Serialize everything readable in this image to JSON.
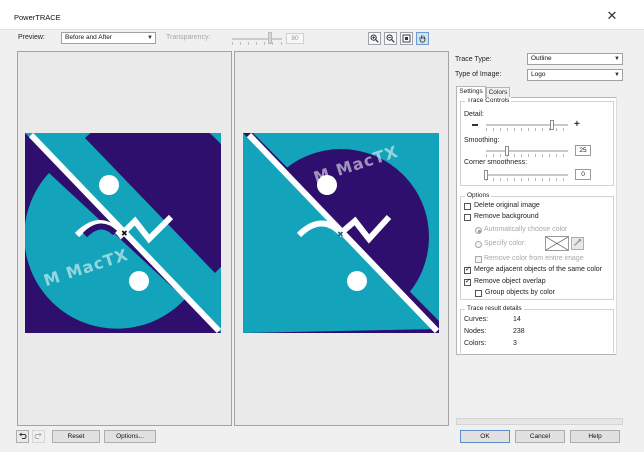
{
  "window": {
    "title": "PowerTRACE"
  },
  "toolbar": {
    "preview_label": "Preview:",
    "preview_value": "Before and After",
    "transparency_label": "Transparency:",
    "transparency_value": "80",
    "transparency_level": 80
  },
  "trace": {
    "type_label": "Trace Type:",
    "type_value": "Outline",
    "image_type_label": "Type of Image:",
    "image_type_value": "Logo"
  },
  "tabs": [
    {
      "label": "Settings",
      "active": true
    },
    {
      "label": "Colors",
      "active": false
    }
  ],
  "trace_controls": {
    "title": "Trace Controls",
    "detail_label": "Detail:",
    "detail_level": 0.8,
    "smoothing_label": "Smoothing:",
    "smoothing_value": "25",
    "corner_label": "Corner smoothness:",
    "corner_value": "0"
  },
  "options": {
    "title": "Options",
    "delete_original": {
      "label": "Delete original image",
      "checked": false
    },
    "remove_background": {
      "label": "Remove background",
      "checked": false
    },
    "auto_color": {
      "label": "Automatically choose color",
      "checked": true
    },
    "specify_color": {
      "label": "Specify color:",
      "checked": false
    },
    "remove_color_entire": {
      "label": "Remove color from entire image",
      "checked": false
    },
    "merge_adjacent": {
      "label": "Merge adjacent objects of the same color",
      "checked": true
    },
    "remove_overlap": {
      "label": "Remove object overlap",
      "checked": true
    },
    "group_by_color": {
      "label": "Group objects by color",
      "checked": false
    }
  },
  "details": {
    "title": "Trace result details",
    "curves_label": "Curves:",
    "curves_value": "14",
    "nodes_label": "Nodes:",
    "nodes_value": "238",
    "colors_label": "Colors:",
    "colors_value": "3"
  },
  "buttons": {
    "reset": "Reset",
    "options": "Options...",
    "ok": "OK",
    "cancel": "Cancel",
    "help": "Help"
  },
  "logo_colors": {
    "purple": "#2e0f6e",
    "teal": "#13a4bb",
    "white": "#ffffff"
  },
  "icons": {
    "close": "close-icon",
    "zoom_in": "zoom-in-icon",
    "zoom_out": "zoom-out-icon",
    "fit": "fit-icon",
    "pan": "hand-pan-icon",
    "undo": "undo-icon",
    "redo": "redo-icon",
    "eyedropper": "eyedropper-icon"
  }
}
